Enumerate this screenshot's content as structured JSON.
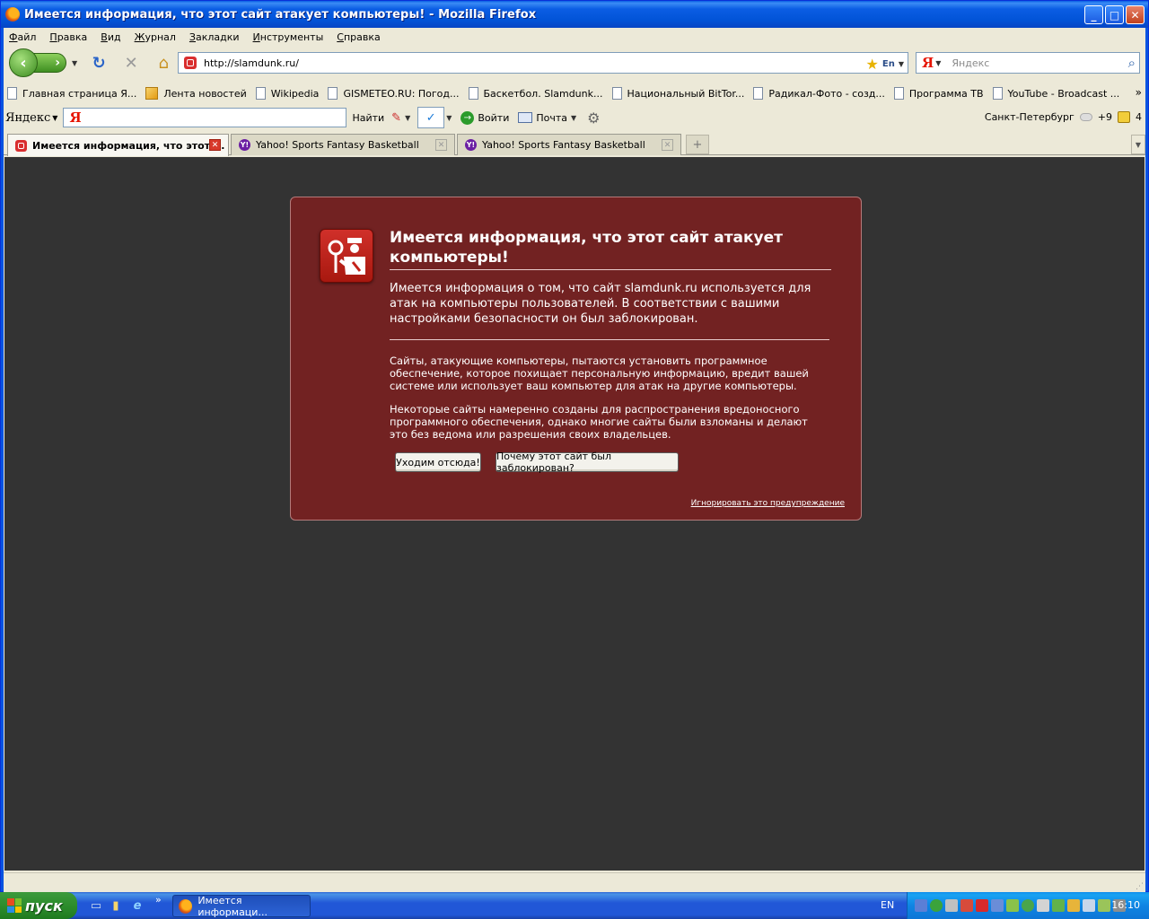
{
  "window": {
    "title": "Имеется информация, что этот сайт атакует компьютеры! - Mozilla Firefox"
  },
  "menu": [
    "Файл",
    "Правка",
    "Вид",
    "Журнал",
    "Закладки",
    "Инструменты",
    "Справка"
  ],
  "nav": {
    "url": "http://slamdunk.ru/",
    "search_engine": "Я",
    "search_placeholder": "Яндекс"
  },
  "bookmarks": [
    {
      "label": "Главная страница Я...",
      "icon": "page-icon"
    },
    {
      "label": "Лента новостей",
      "icon": "rss-icon"
    },
    {
      "label": "Wikipedia",
      "icon": "page-icon"
    },
    {
      "label": "GISMETEO.RU: Погод...",
      "icon": "page-icon"
    },
    {
      "label": "Баскетбол. Slamdunk...",
      "icon": "page-icon"
    },
    {
      "label": "Национальный BitTor...",
      "icon": "page-icon"
    },
    {
      "label": "Радикал-Фото - созд...",
      "icon": "page-icon"
    },
    {
      "label": "Программа ТВ",
      "icon": "page-icon"
    },
    {
      "label": "YouTube - Broadcast ...",
      "icon": "page-icon"
    }
  ],
  "yandex_bar": {
    "logo": "Яндекс",
    "input_logo": "Я",
    "find": "Найти",
    "login": "Войти",
    "mail": "Почта",
    "city": "Санкт-Петербург",
    "temp": "+9",
    "count": "4"
  },
  "tabs": [
    {
      "label": "Имеется информация, что этот ...",
      "active": true,
      "favicon": "blocked-site-icon"
    },
    {
      "label": "Yahoo! Sports Fantasy Basketball",
      "active": false,
      "favicon": "yahoo-icon"
    },
    {
      "label": "Yahoo! Sports Fantasy Basketball",
      "active": false,
      "favicon": "yahoo-icon"
    }
  ],
  "error": {
    "title": "Имеется информация, что этот сайт атакует компьютеры!",
    "short_desc": "Имеется информация о том, что сайт slamdunk.ru используется для атак на компьютеры пользователей. В соответствии с вашими настройками безопасности он был заблокирован.",
    "long_desc_1": "Сайты, атакующие компьютеры, пытаются установить программное обеспечение, которое похищает персональную информацию, вредит вашей системе или использует ваш компьютер для атак на другие компьютеры.",
    "long_desc_2": "Некоторые сайты намеренно созданы для распространения вредоносного программного обеспечения, однако многие сайты были взломаны и делают это без ведома или разрешения своих владельцев.",
    "get_me_out": "Уходим отсюда!",
    "why_blocked": "Почему этот сайт был заблокирован?",
    "ignore": "Игнорировать это предупреждение"
  },
  "taskbar": {
    "start": "пуск",
    "task_label": "Имеется информаци...",
    "lang": "EN",
    "clock": "16:10"
  },
  "colors": {
    "error_bg": "#722222",
    "content_bg": "#333333",
    "accent_red": "#d92e2e",
    "xp_blue": "#0254d8"
  }
}
